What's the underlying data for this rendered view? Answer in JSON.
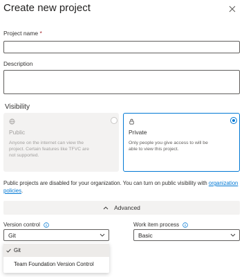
{
  "dialog": {
    "title": "Create new project"
  },
  "form": {
    "project_name_label": "Project name",
    "required_mark": "*",
    "project_name_value": "",
    "description_label": "Description",
    "description_value": ""
  },
  "visibility": {
    "section_label": "Visibility",
    "options": [
      {
        "name": "Public",
        "description": "Anyone on the internet can view the project. Certain features like TFVC are not supported.",
        "icon": "globe-icon",
        "selected": false,
        "disabled": true
      },
      {
        "name": "Private",
        "description": "Only people you give access to will be able to view this project.",
        "icon": "lock-icon",
        "selected": true,
        "disabled": false
      }
    ],
    "note_text": "Public projects are disabled for your organization. You can turn on public visibility with",
    "note_link": "organization policies",
    "note_end": "."
  },
  "advanced": {
    "label": "Advanced",
    "icon": "chevron-up-icon"
  },
  "version_control": {
    "label": "Version control",
    "value": "Git",
    "options": [
      "Git",
      "Team Foundation Version Control"
    ]
  },
  "work_item_process": {
    "label": "Work item process",
    "value": "Basic"
  },
  "colors": {
    "accent": "#0078d4",
    "required": "#a4262c",
    "disabled_card": "#f3f2f1"
  }
}
